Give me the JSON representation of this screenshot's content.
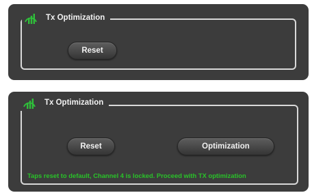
{
  "colors": {
    "panel_bg": "#3c3c3c",
    "frame": "#d9d9d9",
    "status_text": "#29c229",
    "icon": "#2fbf3a"
  },
  "panels": [
    {
      "title": "Tx Optimization",
      "icon": "signal-bars-icon",
      "reset_label": "Reset"
    },
    {
      "title": "Tx Optimization",
      "icon": "signal-bars-icon",
      "reset_label": "Reset",
      "optimization_label": "Optimization",
      "status": "Taps reset to default, Channel 4 is locked. Proceed with TX optimization"
    }
  ]
}
